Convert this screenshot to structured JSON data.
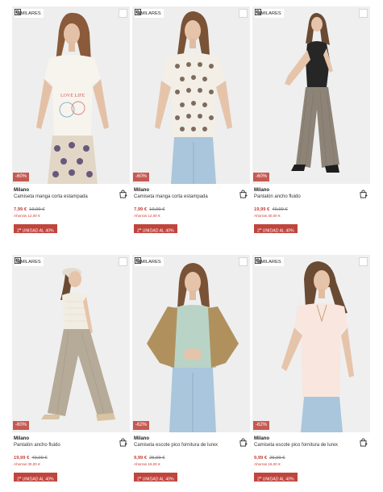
{
  "labels": {
    "similares": "SIMILARES",
    "icons": {
      "similares": "similar-search-icon",
      "favorite": "favorite-checkbox-icon",
      "bag": "add-to-bag-icon"
    }
  },
  "colors": {
    "discount_badge": "#c45a52",
    "price_red": "#c4423a",
    "promo_bg": "#c0453d"
  },
  "products": [
    {
      "brand": "Milano",
      "name": "Camiseta manga corta estampada",
      "discount": "-60%",
      "price": "7,99 €",
      "old_price": "19,99 €",
      "saving": "Ahorras 12,00 €",
      "promo_num": "2",
      "promo_sup": "a",
      "promo_rest": " UNIDAD AL 40%"
    },
    {
      "brand": "Milano",
      "name": "Camiseta manga corta estampada",
      "discount": "-60%",
      "price": "7,99 €",
      "old_price": "19,99 €",
      "saving": "Ahorras 12,00 €",
      "promo_num": "2",
      "promo_sup": "a",
      "promo_rest": " UNIDAD AL 40%"
    },
    {
      "brand": "Milano",
      "name": "Pantalón ancho fluido",
      "discount": "-60%",
      "price": "19,99 €",
      "old_price": "49,99 €",
      "saving": "Ahorras 30,00 €",
      "promo_num": "2",
      "promo_sup": "a",
      "promo_rest": " UNIDAD AL 40%"
    },
    {
      "brand": "Milano",
      "name": "Pantalón ancho fluido",
      "discount": "-60%",
      "price": "19,99 €",
      "old_price": "49,99 €",
      "saving": "Ahorras 30,00 €",
      "promo_num": "2",
      "promo_sup": "a",
      "promo_rest": " UNIDAD AL 40%"
    },
    {
      "brand": "Milano",
      "name": "Camiseta escote pico fornitura de lurex",
      "discount": "-62%",
      "price": "9,99 €",
      "old_price": "25,99 €",
      "saving": "Ahorras 16,00 €",
      "promo_num": "2",
      "promo_sup": "a",
      "promo_rest": " UNIDAD AL 40%"
    },
    {
      "brand": "Milano",
      "name": "Camiseta escote pico fornitura de lurex",
      "discount": "-62%",
      "price": "9,99 €",
      "old_price": "25,99 €",
      "saving": "Ahorras 16,00 €",
      "promo_num": "2",
      "promo_sup": "a",
      "promo_rest": " UNIDAD AL 40%"
    }
  ]
}
